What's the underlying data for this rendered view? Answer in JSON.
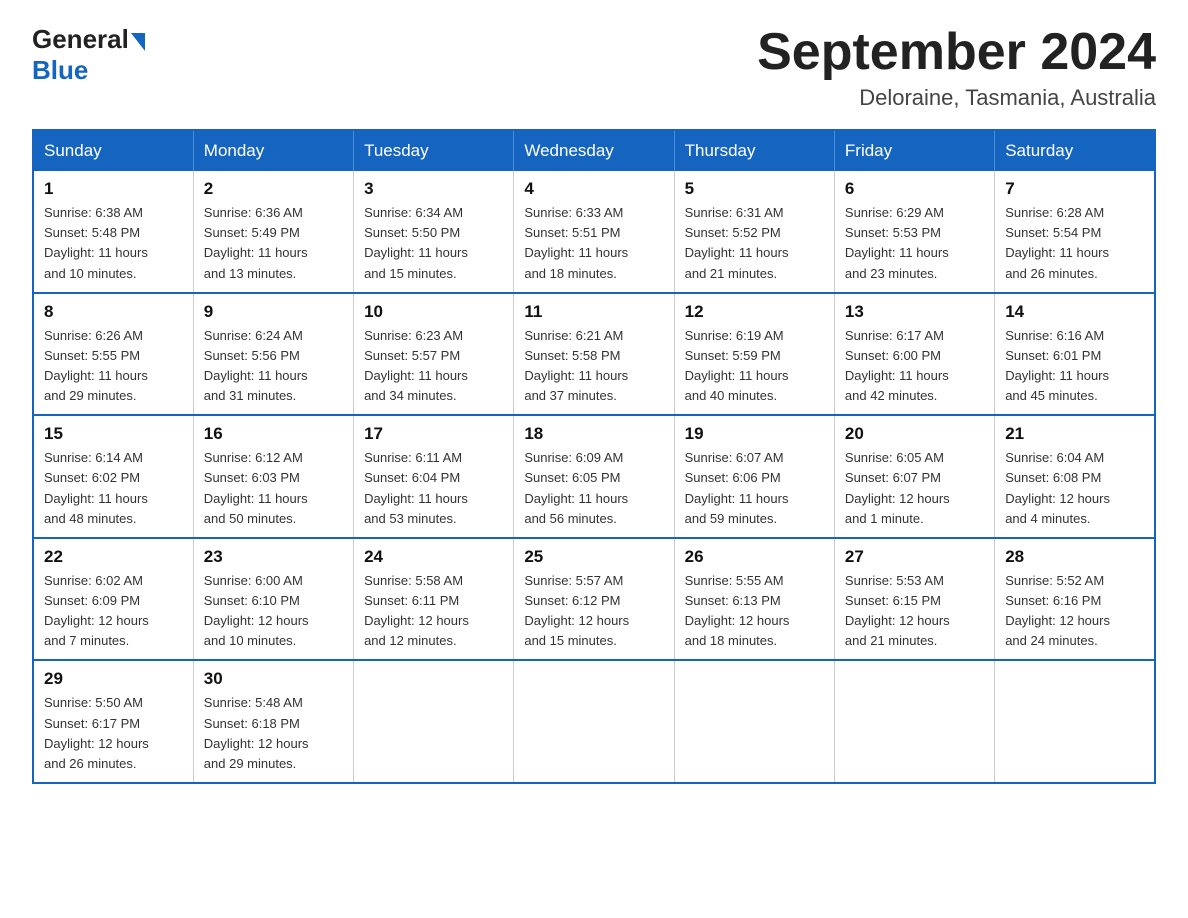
{
  "logo": {
    "general": "General",
    "blue": "Blue"
  },
  "title": "September 2024",
  "subtitle": "Deloraine, Tasmania, Australia",
  "days_of_week": [
    "Sunday",
    "Monday",
    "Tuesday",
    "Wednesday",
    "Thursday",
    "Friday",
    "Saturday"
  ],
  "weeks": [
    [
      {
        "day": "1",
        "sunrise": "6:38 AM",
        "sunset": "5:48 PM",
        "daylight": "11 hours and 10 minutes."
      },
      {
        "day": "2",
        "sunrise": "6:36 AM",
        "sunset": "5:49 PM",
        "daylight": "11 hours and 13 minutes."
      },
      {
        "day": "3",
        "sunrise": "6:34 AM",
        "sunset": "5:50 PM",
        "daylight": "11 hours and 15 minutes."
      },
      {
        "day": "4",
        "sunrise": "6:33 AM",
        "sunset": "5:51 PM",
        "daylight": "11 hours and 18 minutes."
      },
      {
        "day": "5",
        "sunrise": "6:31 AM",
        "sunset": "5:52 PM",
        "daylight": "11 hours and 21 minutes."
      },
      {
        "day": "6",
        "sunrise": "6:29 AM",
        "sunset": "5:53 PM",
        "daylight": "11 hours and 23 minutes."
      },
      {
        "day": "7",
        "sunrise": "6:28 AM",
        "sunset": "5:54 PM",
        "daylight": "11 hours and 26 minutes."
      }
    ],
    [
      {
        "day": "8",
        "sunrise": "6:26 AM",
        "sunset": "5:55 PM",
        "daylight": "11 hours and 29 minutes."
      },
      {
        "day": "9",
        "sunrise": "6:24 AM",
        "sunset": "5:56 PM",
        "daylight": "11 hours and 31 minutes."
      },
      {
        "day": "10",
        "sunrise": "6:23 AM",
        "sunset": "5:57 PM",
        "daylight": "11 hours and 34 minutes."
      },
      {
        "day": "11",
        "sunrise": "6:21 AM",
        "sunset": "5:58 PM",
        "daylight": "11 hours and 37 minutes."
      },
      {
        "day": "12",
        "sunrise": "6:19 AM",
        "sunset": "5:59 PM",
        "daylight": "11 hours and 40 minutes."
      },
      {
        "day": "13",
        "sunrise": "6:17 AM",
        "sunset": "6:00 PM",
        "daylight": "11 hours and 42 minutes."
      },
      {
        "day": "14",
        "sunrise": "6:16 AM",
        "sunset": "6:01 PM",
        "daylight": "11 hours and 45 minutes."
      }
    ],
    [
      {
        "day": "15",
        "sunrise": "6:14 AM",
        "sunset": "6:02 PM",
        "daylight": "11 hours and 48 minutes."
      },
      {
        "day": "16",
        "sunrise": "6:12 AM",
        "sunset": "6:03 PM",
        "daylight": "11 hours and 50 minutes."
      },
      {
        "day": "17",
        "sunrise": "6:11 AM",
        "sunset": "6:04 PM",
        "daylight": "11 hours and 53 minutes."
      },
      {
        "day": "18",
        "sunrise": "6:09 AM",
        "sunset": "6:05 PM",
        "daylight": "11 hours and 56 minutes."
      },
      {
        "day": "19",
        "sunrise": "6:07 AM",
        "sunset": "6:06 PM",
        "daylight": "11 hours and 59 minutes."
      },
      {
        "day": "20",
        "sunrise": "6:05 AM",
        "sunset": "6:07 PM",
        "daylight": "12 hours and 1 minute."
      },
      {
        "day": "21",
        "sunrise": "6:04 AM",
        "sunset": "6:08 PM",
        "daylight": "12 hours and 4 minutes."
      }
    ],
    [
      {
        "day": "22",
        "sunrise": "6:02 AM",
        "sunset": "6:09 PM",
        "daylight": "12 hours and 7 minutes."
      },
      {
        "day": "23",
        "sunrise": "6:00 AM",
        "sunset": "6:10 PM",
        "daylight": "12 hours and 10 minutes."
      },
      {
        "day": "24",
        "sunrise": "5:58 AM",
        "sunset": "6:11 PM",
        "daylight": "12 hours and 12 minutes."
      },
      {
        "day": "25",
        "sunrise": "5:57 AM",
        "sunset": "6:12 PM",
        "daylight": "12 hours and 15 minutes."
      },
      {
        "day": "26",
        "sunrise": "5:55 AM",
        "sunset": "6:13 PM",
        "daylight": "12 hours and 18 minutes."
      },
      {
        "day": "27",
        "sunrise": "5:53 AM",
        "sunset": "6:15 PM",
        "daylight": "12 hours and 21 minutes."
      },
      {
        "day": "28",
        "sunrise": "5:52 AM",
        "sunset": "6:16 PM",
        "daylight": "12 hours and 24 minutes."
      }
    ],
    [
      {
        "day": "29",
        "sunrise": "5:50 AM",
        "sunset": "6:17 PM",
        "daylight": "12 hours and 26 minutes."
      },
      {
        "day": "30",
        "sunrise": "5:48 AM",
        "sunset": "6:18 PM",
        "daylight": "12 hours and 29 minutes."
      },
      null,
      null,
      null,
      null,
      null
    ]
  ],
  "labels": {
    "sunrise": "Sunrise:",
    "sunset": "Sunset:",
    "daylight": "Daylight:"
  }
}
